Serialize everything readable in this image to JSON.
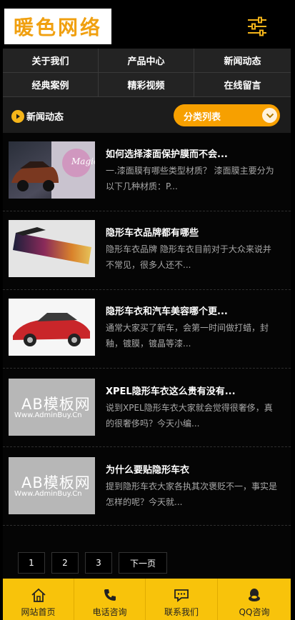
{
  "brand": {
    "logo": "暖色网络"
  },
  "nav": {
    "items": [
      "关于我们",
      "产品中心",
      "新闻动态",
      "经典案例",
      "精彩视频",
      "在线留言"
    ]
  },
  "section": {
    "title": "新闻动态",
    "category_button": "分类列表"
  },
  "articles": [
    {
      "title": "如何选择漆面保护膜而不会...",
      "desc": "一.漆面膜有哪些类型材质？ 漆面膜主要分为以下几种材质：P..."
    },
    {
      "title": "隐形车衣品牌都有哪些",
      "desc": "隐形车衣品牌 隐形车衣目前对于大众来说并不常见，很多人还不..."
    },
    {
      "title": "隐形车衣和汽车美容哪个更...",
      "desc": "通常大家买了新车，会第一时间做打蜡，封釉，镀膜，镀晶等漆..."
    },
    {
      "title": "XPEL隐形车衣这么贵有没有...",
      "desc": "说到XPEL隐形车衣大家就会觉得很奢侈，真的很奢侈吗？今天小编..."
    },
    {
      "title": "为什么要贴隐形车衣",
      "desc": "提到隐形车衣大家各执其次褒贬不一，事实是怎样的呢？今天就..."
    }
  ],
  "thumb_text": {
    "magic": "Magic",
    "placeholder_big": "AB模板网",
    "placeholder_small": "Www.AdminBuy.Cn"
  },
  "pagination": {
    "pages": [
      "1",
      "2",
      "3"
    ],
    "next": "下一页"
  },
  "bottom_bar": {
    "items": [
      "网站首页",
      "电话咨询",
      "联系我们",
      "QQ咨询"
    ]
  },
  "colors": {
    "accent": "#f7a000",
    "bottom_bar": "#f8c30b",
    "logo": "#f0a010"
  }
}
